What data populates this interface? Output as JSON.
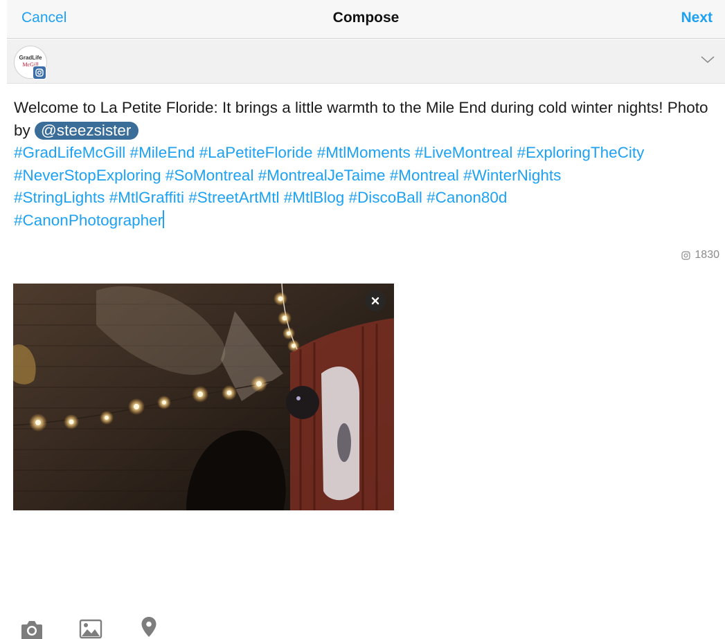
{
  "header": {
    "cancel_label": "Cancel",
    "title": "Compose",
    "next_label": "Next"
  },
  "account": {
    "avatar_line1": "GradLife",
    "avatar_line2": "McGill"
  },
  "compose": {
    "text_intro": "Welcome to La Petite Floride: It brings a little warmth to the Mile End during cold winter nights! Photo by ",
    "mention": "@steezsister",
    "hashtags_line1": "#GradLifeMcGill #MileEnd #LaPetiteFloride #MtlMoments #LiveMontreal #ExploringTheCity",
    "hashtags_line2": "#NeverStopExploring #SoMontreal #MontrealJeTaime #Montreal #WinterNights",
    "hashtags_line3": "#StringLights #MtlGraffiti #StreetArtMtl #MtlBlog #DiscoBall #Canon80d",
    "hashtags_line4": "#CanonPhotographer"
  },
  "char_count": "1830",
  "icons": {
    "chevron": "chevron-down-icon",
    "counter": "instagram-icon",
    "remove": "close-icon",
    "camera": "camera-icon",
    "gallery": "image-icon",
    "location": "location-pin-icon"
  },
  "colors": {
    "accent": "#1da1f2",
    "mention_bg": "#3a6d98",
    "toolbar_icon": "#7d7d7d"
  }
}
